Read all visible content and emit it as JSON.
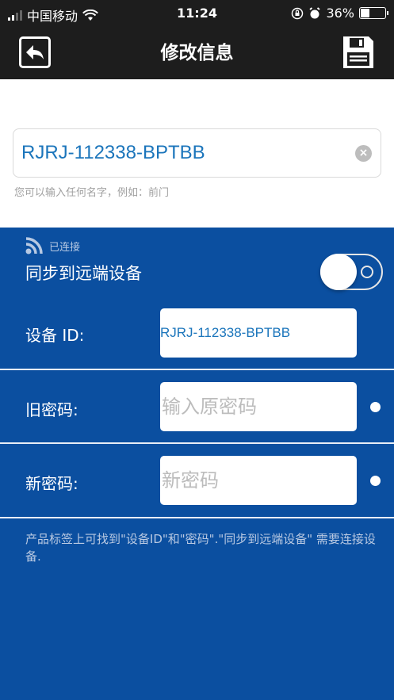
{
  "status_bar": {
    "carrier": "中国移动",
    "time": "11:24",
    "battery_percent": "36%",
    "battery_level": 0.36
  },
  "header": {
    "title": "修改信息",
    "back_icon": "back-arrow-icon",
    "save_icon": "floppy-disk-save-icon"
  },
  "device_name": {
    "value": "RJRJ-112338-BPTBB",
    "hint": "您可以输入任何名字，例如：前门"
  },
  "sync": {
    "status": "已连接",
    "label": "同步到远端设备",
    "toggle_on": false
  },
  "device_id": {
    "label": "设备 ID:",
    "value": "RJRJ-112338-BPTBB"
  },
  "old_password": {
    "label": "旧密码:",
    "placeholder": "输入原密码"
  },
  "new_password": {
    "label": "新密码:",
    "placeholder": "新密码"
  },
  "note": "产品标签上可找到\"设备ID\"和\"密码\".\"同步到远端设备\" 需要连接设备.",
  "colors": {
    "header_bg": "#1d1d1d",
    "panel_bg": "#0b4fa0",
    "accent_text": "#1b75bb"
  }
}
